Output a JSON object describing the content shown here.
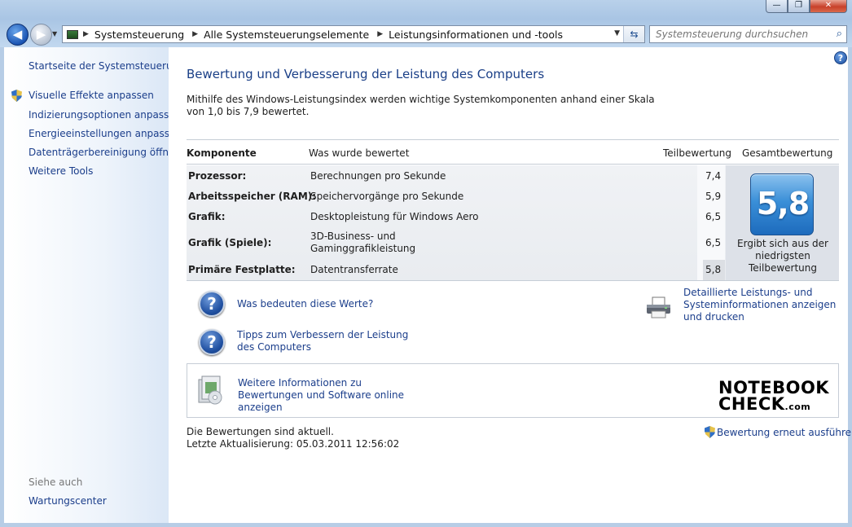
{
  "window": {
    "controls": {
      "minimize": "—",
      "maximize": "❐",
      "close": "✕"
    }
  },
  "nav": {
    "back_icon": "arrow-left-icon",
    "forward_icon": "arrow-right-icon",
    "back_glyph": "◀",
    "forward_glyph": "▶",
    "history_glyph": "▼",
    "breadcrumbs": [
      "Systemsteuerung",
      "Alle Systemsteuerungselemente",
      "Leistungsinformationen und -tools"
    ],
    "search_placeholder": "Systemsteuerung durchsuchen"
  },
  "sidebar": {
    "home": "Startseite der Systemsteuerung",
    "items": [
      "Visuelle Effekte anpassen",
      "Indizierungsoptionen anpassen",
      "Energieeinstellungen anpassen",
      "Datenträgerbereinigung öffnen",
      "Weitere Tools"
    ],
    "see_also_heading": "Siehe auch",
    "see_also_items": [
      "Wartungscenter"
    ]
  },
  "main": {
    "title": "Bewertung und Verbesserung der Leistung des Computers",
    "description": "Mithilfe des Windows-Leistungsindex werden wichtige Systemkomponenten anhand einer Skala von 1,0 bis 7,9 bewertet.",
    "table": {
      "headers": {
        "component": "Komponente",
        "rated": "Was wurde bewertet",
        "subscore": "Teilbewertung",
        "basescore": "Gesamtbewertung"
      },
      "rows": [
        {
          "component": "Prozessor:",
          "rated": "Berechnungen pro Sekunde",
          "score": "7,4"
        },
        {
          "component": "Arbeitsspeicher (RAM):",
          "rated": "Speichervorgänge pro Sekunde",
          "score": "5,9"
        },
        {
          "component": "Grafik:",
          "rated": "Desktopleistung für Windows Aero",
          "score": "6,5"
        },
        {
          "component": "Grafik (Spiele):",
          "rated": "3D-Business- und Gaminggrafikleistung",
          "score": "6,5"
        },
        {
          "component": "Primäre Festplatte:",
          "rated": "Datentransferrate",
          "score": "5,8"
        }
      ],
      "base_score": "5,8",
      "base_score_caption": "Ergibt sich aus der niedrigsten Teilbewertung"
    },
    "links": {
      "what_mean": "Was bedeuten diese Werte?",
      "tips": "Tipps zum Verbessern der Leistung des Computers",
      "detailed": "Detaillierte Leistungs- und Systeminformationen anzeigen und drucken",
      "more_info": "Weitere Informationen zu Bewertungen und Software online anzeigen"
    },
    "watermark": {
      "line1": "NOTEBOOK",
      "line2": "CHECK",
      "suffix": ".com"
    },
    "status": {
      "current": "Die Bewertungen sind aktuell.",
      "last_update": "Letzte Aktualisierung: 05.03.2011 12:56:02",
      "rerun": "Bewertung erneut ausführen"
    }
  }
}
